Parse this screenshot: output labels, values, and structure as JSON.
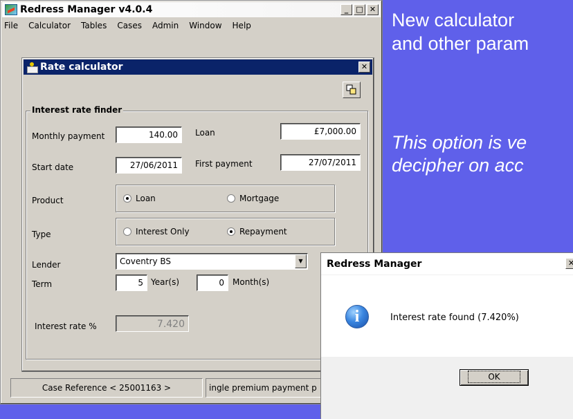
{
  "slide": {
    "line1": "New calculator",
    "line2": "and other param",
    "line3": "This option is ve",
    "line4": "decipher on acc"
  },
  "app": {
    "title": "Redress Manager v4.0.4",
    "menu": [
      "File",
      "Calculator",
      "Tables",
      "Cases",
      "Admin",
      "Window",
      "Help"
    ],
    "buttons": {
      "minimize": "_",
      "maximize": "□",
      "close": "✕"
    }
  },
  "calculator": {
    "title": "Rate calculator",
    "close": "✕",
    "group_label": "Interest rate finder",
    "monthly_payment_label": "Monthly payment",
    "monthly_payment": "140.00",
    "loan_label": "Loan",
    "loan": "£7,000.00",
    "start_date_label": "Start date",
    "start_date": "27/06/2011",
    "first_payment_label": "First payment",
    "first_payment": "27/07/2011",
    "product_label": "Product",
    "product_options": [
      "Loan",
      "Mortgage"
    ],
    "product_selected": "Loan",
    "type_label": "Type",
    "type_options": [
      "Interest Only",
      "Repayment"
    ],
    "type_selected": "Repayment",
    "lender_label": "Lender",
    "lender": "Coventry BS",
    "term_label": "Term",
    "term_years": "5",
    "years_label": "Year(s)",
    "term_months": "0",
    "months_label": "Month(s)",
    "interest_rate_label": "Interest rate %",
    "interest_rate": "7.420"
  },
  "statusbar": {
    "case_reference": "Case Reference < 25001163 >",
    "info": "ingle premium payment p"
  },
  "message_box": {
    "title": "Redress Manager",
    "close": "✕",
    "message": "Interest rate found (7.420%)",
    "ok_label": "OK"
  },
  "colors": {
    "slide_background": "#5f60ea",
    "child_titlebar": "#0a2369",
    "window_face": "#d4d0c8"
  }
}
